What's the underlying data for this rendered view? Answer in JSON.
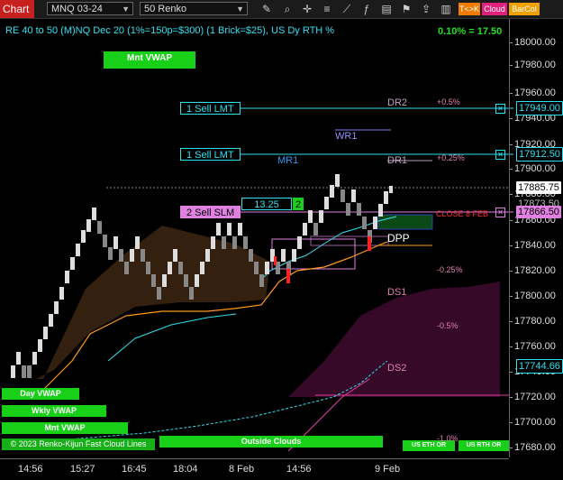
{
  "toolbar": {
    "tab": "Chart",
    "instrument": "MNQ 03-24",
    "bar_type": "50 Renko",
    "btn_tk": "T<>K",
    "btn_cloud": "Cloud",
    "btn_barcol": "BarCol"
  },
  "header": {
    "title": "RE 40 to 50 (M)NQ Dec 20 (1%=150p=$300) (1 Brick=$25), US Dy RTH %",
    "pct_top": "0.10% = 17.50"
  },
  "y_axis": {
    "ticks": [
      "18000.00",
      "17980.00",
      "17960.00",
      "17940.00",
      "17920.00",
      "17900.00",
      "17880.00",
      "17860.00",
      "17840.00",
      "17820.00",
      "17800.00",
      "17780.00",
      "17760.00",
      "17740.00",
      "17720.00",
      "17700.00",
      "17680.00"
    ],
    "tags": {
      "dr2": "17949.00",
      "dr1": "17912.50",
      "last": "17885.75",
      "close": "17873.50",
      "sell_slm": "17866.50",
      "ds2": "17744.66"
    }
  },
  "x_axis": {
    "ticks": [
      "14:56",
      "15:27",
      "16:45",
      "18:04",
      "8 Feb",
      "14:56",
      "9 Feb"
    ]
  },
  "labels": {
    "mnt_vwap_top": "Mnt VWAP",
    "sell_lmt_1": "1 Sell LMT",
    "sell_lmt_2": "1 Sell LMT",
    "sell_slm": "2 Sell SLM",
    "order_price": "13.25",
    "order_qty": "2",
    "wr1": "WR1",
    "mr1": "MR1",
    "dr2": "DR2",
    "dr1": "DR1",
    "dpp": "DPP",
    "ds1": "DS1",
    "ds2": "DS2",
    "close_feb": "CLOSE 8 FEB",
    "p05": "+0.5%",
    "p025": "+0.25%",
    "m025": "-0.25%",
    "m05": "-0.5%",
    "m10": "-1.0%",
    "day_vwap": "Day VWAP",
    "wkly_vwap": "Wkly VWAP",
    "mnt_vwap_bottom": "Mnt VWAP",
    "copyright": "© 2023 Renko-Kijun Fast Cloud Lines",
    "outside_clouds": "Outside Clouds",
    "us_eth": "US ETH OR",
    "us_rth": "US RTH OR"
  },
  "colors": {
    "accent": "#2ee0f0",
    "green": "#18d018",
    "pink": "#e080e0",
    "red": "#ff2020",
    "orange": "#ff9a20",
    "cloud_brown": "#3a2410",
    "cloud_purple": "#3a0a2a"
  },
  "chart_data": {
    "type": "renko",
    "y_range": [
      17675,
      18010
    ],
    "levels": {
      "DR2": 17949.0,
      "DR1": 17912.5,
      "last": 17885.75,
      "close_8_feb": 17873.5,
      "sell_slm": 17866.5,
      "DS2": 17744.66
    }
  }
}
